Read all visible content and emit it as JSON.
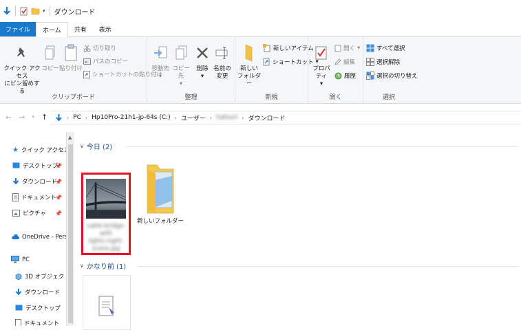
{
  "window": {
    "title": "ダウンロード"
  },
  "tabs": [
    {
      "label": "ファイル",
      "kind": "file"
    },
    {
      "label": "ホーム",
      "kind": "active"
    },
    {
      "label": "共有",
      "kind": ""
    },
    {
      "label": "表示",
      "kind": ""
    }
  ],
  "ribbon": {
    "clipboard": {
      "label": "クリップボード",
      "quick_access_line1": "クイック アクセス",
      "quick_access_line2": "にピン留めする",
      "copy": "コピー",
      "paste": "貼り付け",
      "cut": "切り取り",
      "copy_path": "パスのコピー",
      "paste_shortcut": "ショートカットの貼り付け"
    },
    "organize": {
      "label": "整理",
      "move_to": "移動先",
      "copy_to": "コピー先",
      "delete": "削除",
      "rename_line1": "名前の",
      "rename_line2": "変更"
    },
    "new": {
      "label": "新規",
      "new_folder_line1": "新しい",
      "new_folder_line2": "フォルダー",
      "new_item": "新しいアイテム",
      "shortcut": "ショートカット"
    },
    "open": {
      "label": "開く",
      "properties": "プロパティ",
      "open": "開く",
      "edit": "編集",
      "history": "履歴"
    },
    "select": {
      "label": "選択",
      "select_all": "すべて選択",
      "select_none": "選択解除",
      "invert": "選択の切り替え"
    }
  },
  "address": {
    "crumbs": [
      "PC",
      "Hp10Pro-21h1-jp-64s (C:)",
      "ユーザー",
      "hatsuri",
      "ダウンロード"
    ]
  },
  "navpane": {
    "quick_access": "クイック アクセス",
    "items_pinned": [
      "デスクトップ",
      "ダウンロード",
      "ドキュメント",
      "ピクチャ"
    ],
    "onedrive": "OneDrive - Person",
    "pc": "PC",
    "pc_items": [
      "3D オブジェクト",
      "ダウンロード",
      "デスクトップ",
      "ドキュメント"
    ]
  },
  "content": {
    "groups": [
      {
        "label": "今日 (2)"
      },
      {
        "label": "かなり前 (1)"
      }
    ],
    "files": [
      {
        "name_line1": "cable-bridge-with",
        "name_line2": "lights-night-",
        "name_line3": "scene.jpg"
      },
      {
        "name": "新しいフォルダー"
      }
    ]
  },
  "colors": {
    "file_tab": "#1979ca",
    "highlight": "#e81123",
    "group_header": "#1e4e8c"
  }
}
